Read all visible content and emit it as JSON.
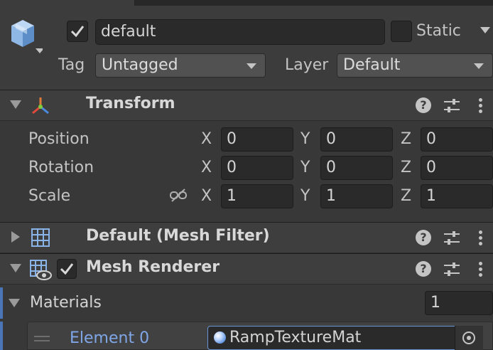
{
  "game_object": {
    "active": true,
    "name": "default",
    "static_label": "Static",
    "static_checked": false,
    "tag_label": "Tag",
    "tag_value": "Untagged",
    "layer_label": "Layer",
    "layer_value": "Default"
  },
  "components": {
    "transform": {
      "title": "Transform",
      "expanded": true,
      "rows": [
        {
          "label": "Position",
          "x": "0",
          "y": "0",
          "z": "0"
        },
        {
          "label": "Rotation",
          "x": "0",
          "y": "0",
          "z": "0"
        },
        {
          "label": "Scale",
          "x": "1",
          "y": "1",
          "z": "1"
        }
      ],
      "axis_labels": {
        "x": "X",
        "y": "Y",
        "z": "Z"
      }
    },
    "mesh_filter": {
      "title": "Default (Mesh Filter)",
      "expanded": false
    },
    "mesh_renderer": {
      "title": "Mesh Renderer",
      "enabled": true,
      "expanded": true,
      "materials_label": "Materials",
      "materials_count": "1",
      "element_label": "Element 0",
      "element_value": "RampTextureMat"
    }
  },
  "icons": {
    "help": "?",
    "colors": {
      "accent_blue": "#4a76b8",
      "element_label_blue": "#7fa7e8",
      "transform_icon_red": "#e04a3a",
      "transform_icon_green": "#7dcc3c",
      "transform_icon_blue": "#4a8ae0"
    }
  }
}
